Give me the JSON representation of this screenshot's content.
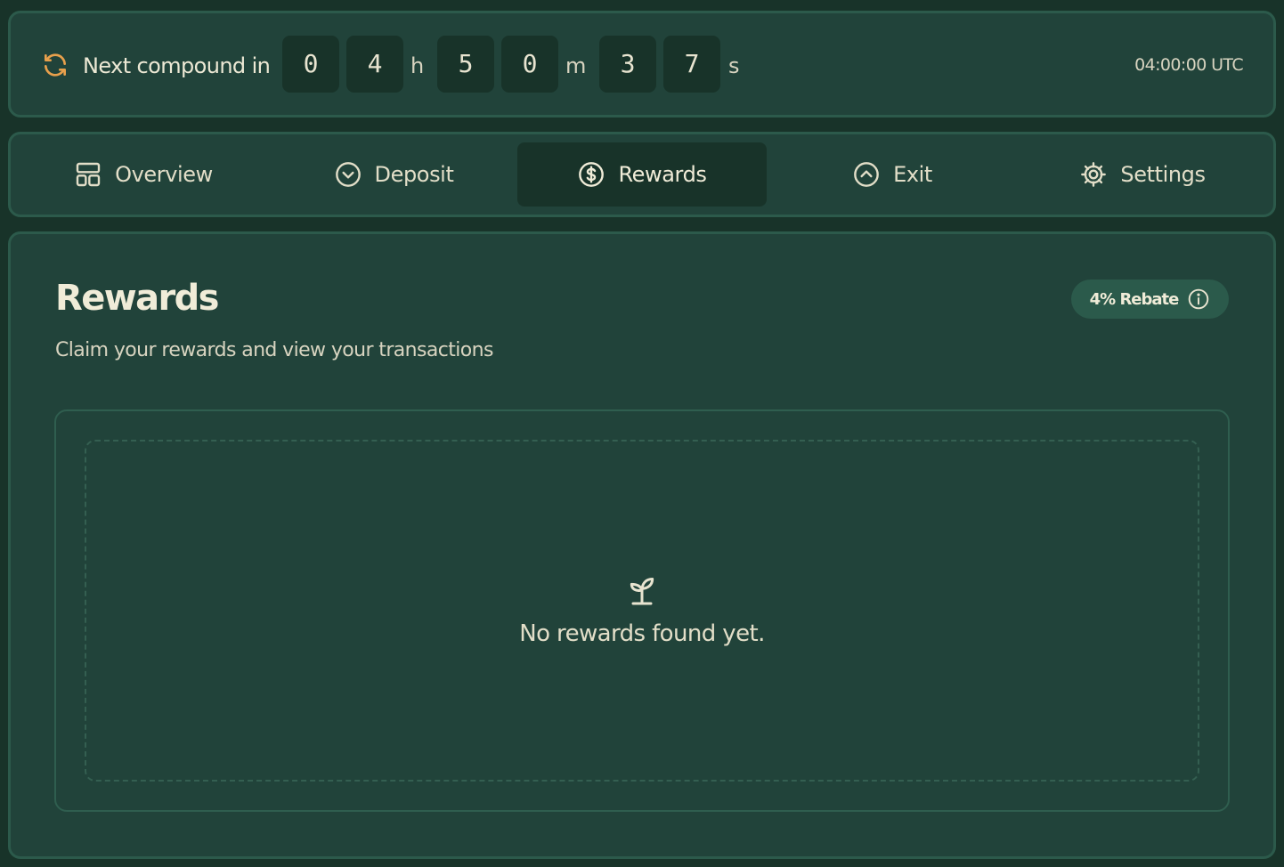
{
  "countdown": {
    "label": "Next compound in",
    "hours": [
      "0",
      "4"
    ],
    "minutes": [
      "5",
      "0"
    ],
    "seconds": [
      "3",
      "7"
    ],
    "unit_h": "h",
    "unit_m": "m",
    "unit_s": "s",
    "utc_time": "04:00:00 UTC",
    "icon": "refresh-icon"
  },
  "tabs": [
    {
      "label": "Overview",
      "icon": "layout-icon",
      "active": false
    },
    {
      "label": "Deposit",
      "icon": "chevron-down-circle-icon",
      "active": false
    },
    {
      "label": "Rewards",
      "icon": "dollar-circle-icon",
      "active": true
    },
    {
      "label": "Exit",
      "icon": "chevron-up-circle-icon",
      "active": false
    },
    {
      "label": "Settings",
      "icon": "gear-icon",
      "active": false
    }
  ],
  "main": {
    "title": "Rewards",
    "subtitle": "Claim your rewards and view your transactions",
    "rebate_label": "4% Rebate",
    "empty_state_text": "No rewards found yet.",
    "empty_state_icon": "sprout-icon"
  },
  "colors": {
    "background": "#183329",
    "panel": "#21433a",
    "accent_orange": "#e8a04c",
    "text": "#e8e4d0"
  }
}
